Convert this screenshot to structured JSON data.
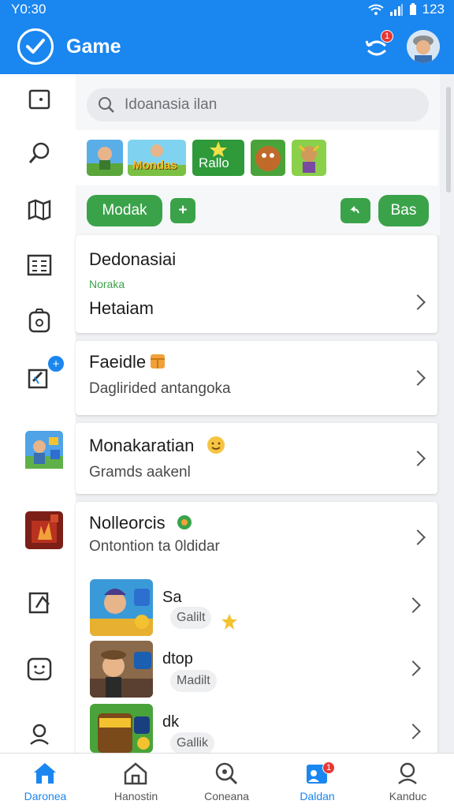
{
  "status": {
    "time": "Y0:30",
    "battery": "123"
  },
  "app": {
    "title": "Game",
    "notification_count": "1"
  },
  "search": {
    "placeholder": "Idoanasia ilan"
  },
  "thumbs": [
    "",
    "Mondas",
    "Rallo",
    "",
    ""
  ],
  "chips": {
    "left": "Modak",
    "plus": "+",
    "right": "Bas"
  },
  "cards": [
    {
      "title": "Dedonasiai",
      "tag": "Noraka",
      "sub": "Hetaiam"
    },
    {
      "title": "Faeidle",
      "sub": "Daglirided antangoka"
    },
    {
      "title": "Monakaratian",
      "sub": "Gramds aakenl"
    },
    {
      "title": "Nolleorcis",
      "sub": "Ontontion ta 0ldidar"
    }
  ],
  "games": [
    {
      "title": "Sa",
      "pill": "Galilt"
    },
    {
      "title": "dtop",
      "pill": "Madilt"
    },
    {
      "title": "dk",
      "pill": "Gallik"
    }
  ],
  "nav": [
    {
      "label": "Daronea"
    },
    {
      "label": "Hanostin"
    },
    {
      "label": "Coneana"
    },
    {
      "label": "Daldan",
      "badge": "1"
    },
    {
      "label": "Kanduc"
    }
  ],
  "colors": {
    "primary": "#1a86f0",
    "green": "#3aa34a",
    "red": "#e53935"
  }
}
